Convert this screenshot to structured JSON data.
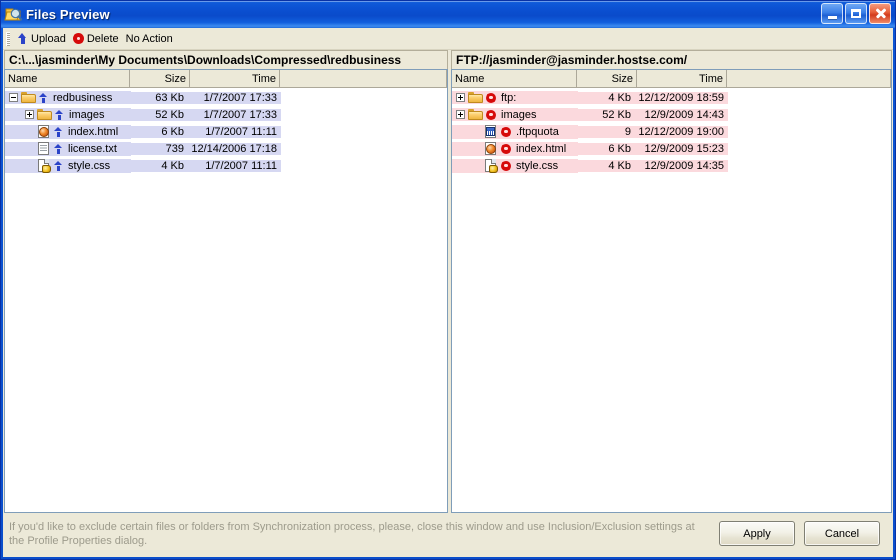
{
  "window": {
    "title": "Files Preview",
    "icon": "files-preview-icon",
    "controls": {
      "minimize": "minimize-button",
      "maximize": "maximize-button",
      "close": "close-button"
    }
  },
  "toolbar": {
    "items": [
      {
        "label": "Upload",
        "icon": "up-arrow-icon"
      },
      {
        "label": "Delete",
        "icon": "red-gear-icon"
      },
      {
        "label": "No Action",
        "icon": "none"
      }
    ]
  },
  "panels": {
    "left": {
      "path": "C:\\...\\jasminder\\My Documents\\Downloads\\Compressed\\redbusiness",
      "columns": [
        "Name",
        "Size",
        "Time"
      ],
      "highlight_color": "#d6d8f2",
      "rows": [
        {
          "name": "redbusiness",
          "size": "63 Kb",
          "time": "1/7/2007 17:33",
          "icon": "folder-icon",
          "action_icon": "up-arrow-icon",
          "indent": 0,
          "expander": "minus"
        },
        {
          "name": "images",
          "size": "52 Kb",
          "time": "1/7/2007 17:33",
          "icon": "folder-icon",
          "action_icon": "up-arrow-icon",
          "indent": 1,
          "expander": "plus"
        },
        {
          "name": "index.html",
          "size": "6 Kb",
          "time": "1/7/2007 11:11",
          "icon": "html-file-icon",
          "action_icon": "up-arrow-icon",
          "indent": 1,
          "expander": "none"
        },
        {
          "name": "license.txt",
          "size": "739",
          "time": "12/14/2006 17:18",
          "icon": "text-file-icon",
          "action_icon": "up-arrow-icon",
          "indent": 1,
          "expander": "none"
        },
        {
          "name": "style.css",
          "size": "4 Kb",
          "time": "1/7/2007 11:11",
          "icon": "css-file-icon",
          "action_icon": "up-arrow-icon",
          "indent": 1,
          "expander": "none"
        }
      ]
    },
    "right": {
      "path": "FTP://jasminder@jasminder.hostse.com/",
      "columns": [
        "Name",
        "Size",
        "Time"
      ],
      "highlight_color": "#fbd9dd",
      "rows": [
        {
          "name": "ftp:",
          "size": "4 Kb",
          "time": "12/12/2009 18:59",
          "icon": "folder-icon",
          "action_icon": "red-gear-icon",
          "indent": 0,
          "expander": "plus"
        },
        {
          "name": "images",
          "size": "52 Kb",
          "time": "12/9/2009 14:43",
          "icon": "folder-icon",
          "action_icon": "red-gear-icon",
          "indent": 0,
          "expander": "plus"
        },
        {
          "name": ".ftpquota",
          "size": "9",
          "time": "12/12/2009 19:00",
          "icon": "quota-file-icon",
          "action_icon": "red-gear-icon",
          "indent": 1,
          "expander": "none"
        },
        {
          "name": "index.html",
          "size": "6 Kb",
          "time": "12/9/2009 15:23",
          "icon": "html-file-icon",
          "action_icon": "red-gear-icon",
          "indent": 1,
          "expander": "none"
        },
        {
          "name": "style.css",
          "size": "4 Kb",
          "time": "12/9/2009 14:35",
          "icon": "css-file-icon",
          "action_icon": "red-gear-icon",
          "indent": 1,
          "expander": "none"
        }
      ]
    }
  },
  "bottom": {
    "status": "If you'd like to exclude certain files or folders from Synchronization process, please, close this window and use Inclusion/Exclusion settings at the Profile Properties dialog.",
    "apply_label": "Apply",
    "cancel_label": "Cancel"
  },
  "colors": {
    "title_blue": "#0B55D4",
    "face": "#ece9d8",
    "left_highlight": "#d6d8f2",
    "right_highlight": "#fbd9dd",
    "upload_arrow": "#2b43c8",
    "delete_gear": "#d60a0a"
  }
}
